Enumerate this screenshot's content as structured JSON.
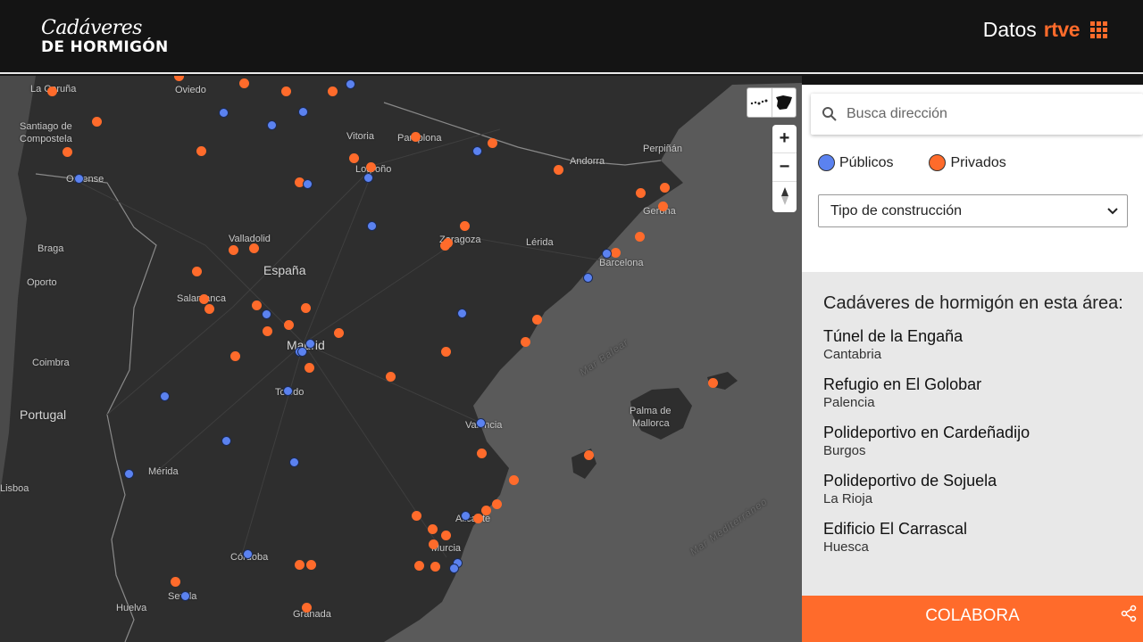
{
  "header": {
    "logo_line1": "Cadáveres",
    "logo_line2": "DE HORMIGÓN",
    "brand_datos": "Datos",
    "brand_rtve": "rtve"
  },
  "map": {
    "labels": [
      {
        "text": "La Coruña",
        "cls": ""
      },
      {
        "text": "Oviedo",
        "cls": ""
      },
      {
        "text": "Santiago de",
        "cls": ""
      },
      {
        "text": "Compostela",
        "cls": ""
      },
      {
        "text": "Vitoria",
        "cls": ""
      },
      {
        "text": "Pamplona",
        "cls": ""
      },
      {
        "text": "Perpiñán",
        "cls": ""
      },
      {
        "text": "Logroño",
        "cls": ""
      },
      {
        "text": "Ourense",
        "cls": ""
      },
      {
        "text": "Andorra",
        "cls": ""
      },
      {
        "text": "Gerona",
        "cls": ""
      },
      {
        "text": "Valladolid",
        "cls": ""
      },
      {
        "text": "Zaragoza",
        "cls": ""
      },
      {
        "text": "Lérida",
        "cls": ""
      },
      {
        "text": "Braga",
        "cls": ""
      },
      {
        "text": "Barcelona",
        "cls": ""
      },
      {
        "text": "España",
        "cls": "big"
      },
      {
        "text": "Oporto",
        "cls": ""
      },
      {
        "text": "Salamanca",
        "cls": ""
      },
      {
        "text": "Madrid",
        "cls": "big"
      },
      {
        "text": "Coimbra",
        "cls": ""
      },
      {
        "text": "Toledo",
        "cls": ""
      },
      {
        "text": "Portugal",
        "cls": "big"
      },
      {
        "text": "Palma de",
        "cls": ""
      },
      {
        "text": "Mallorca",
        "cls": ""
      },
      {
        "text": "Valencia",
        "cls": ""
      },
      {
        "text": "Mérida",
        "cls": ""
      },
      {
        "text": "Lisboa",
        "cls": ""
      },
      {
        "text": "Alicante",
        "cls": ""
      },
      {
        "text": "Murcia",
        "cls": ""
      },
      {
        "text": "Córdoba",
        "cls": ""
      },
      {
        "text": "Sevilla",
        "cls": ""
      },
      {
        "text": "Huelva",
        "cls": ""
      },
      {
        "text": "Granada",
        "cls": ""
      },
      {
        "text": "Mar Balear",
        "cls": "sea"
      },
      {
        "text": "Mar Mediterráneo",
        "cls": "sea"
      }
    ],
    "markers_publicos_count_hint": "blue",
    "zoom_in": "+",
    "zoom_out": "−",
    "compass": "▲"
  },
  "panel": {
    "search_placeholder": "Busca dirección",
    "legend_publicos": "Públicos",
    "legend_privados": "Privados",
    "color_publicos": "#5b82f0",
    "color_privados": "#ff6b2b",
    "select_label": "Tipo de construcción",
    "list_title": "Cadáveres de hormigón en esta área:",
    "entries": [
      {
        "title": "Túnel de la Engaña",
        "region": "Cantabria"
      },
      {
        "title": "Refugio en El Golobar",
        "region": "Palencia"
      },
      {
        "title": "Polideportivo en Cardeñadijo",
        "region": "Burgos"
      },
      {
        "title": "Polideportivo de Sojuela",
        "region": "La Rioja"
      },
      {
        "title": "Edificio El Carrascal",
        "region": "Huesca"
      }
    ],
    "cta": "COLABORA"
  }
}
